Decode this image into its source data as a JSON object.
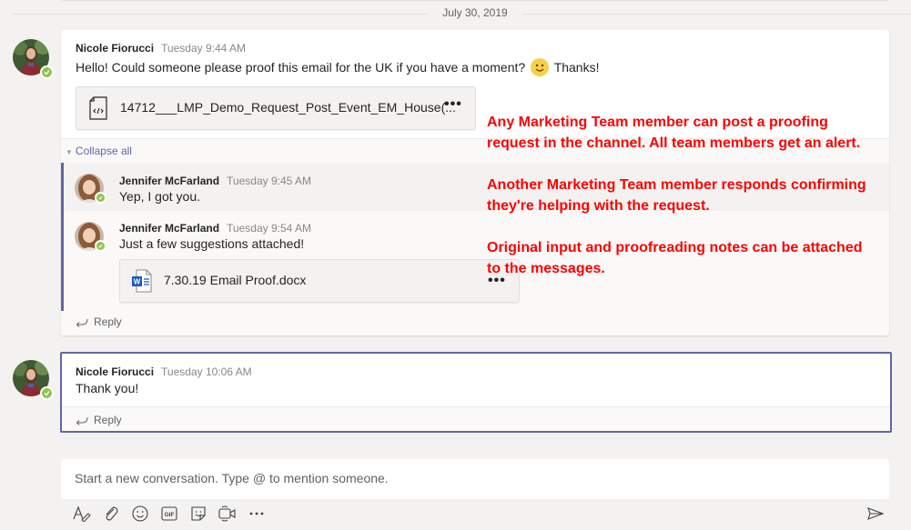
{
  "date_separator": "July 30, 2019",
  "thread1": {
    "author": "Nicole Fiorucci",
    "time": "Tuesday 9:44 AM",
    "text_before_emoji": "Hello! Could someone please proof this email for the UK if you have a moment?",
    "emoji": "smile-emoji",
    "text_after_emoji": "Thanks!",
    "attachment": {
      "icon": "code-file-icon",
      "name": "14712___LMP_Demo_Request_Post_Event_EM_House(...",
      "more": "•••"
    },
    "collapse_label": "Collapse all",
    "replies": [
      {
        "author": "Jennifer McFarland",
        "time": "Tuesday 9:45 AM",
        "text": "Yep, I got you."
      },
      {
        "author": "Jennifer McFarland",
        "time": "Tuesday 9:54 AM",
        "text": "Just a few suggestions attached!",
        "attachment": {
          "icon": "word-file-icon",
          "name": "7.30.19 Email Proof.docx",
          "more": "•••"
        }
      }
    ],
    "reply_label": "Reply"
  },
  "thread2": {
    "author": "Nicole Fiorucci",
    "time": "Tuesday 10:06 AM",
    "text": "Thank you!",
    "reply_label": "Reply"
  },
  "annotations": [
    {
      "line1": "Any Marketing Team member can post a proofing",
      "line2": "request in the channel. All team members get an alert."
    },
    {
      "line1": "Another Marketing Team member responds confirming",
      "line2": "they're helping with the request."
    },
    {
      "line1": "Original input and proofreading notes can be attached",
      "line2": "to the messages."
    }
  ],
  "compose": {
    "placeholder": "Start a new conversation. Type @ to mention someone.",
    "toolbar": [
      "format-icon",
      "attach-icon",
      "emoji-icon",
      "gif-icon",
      "sticker-icon",
      "meet-now-icon",
      "more-options-icon",
      "send-icon"
    ]
  },
  "colors": {
    "accent": "#6264a7",
    "presence": "#92c353",
    "annotation": "#ff0000"
  }
}
